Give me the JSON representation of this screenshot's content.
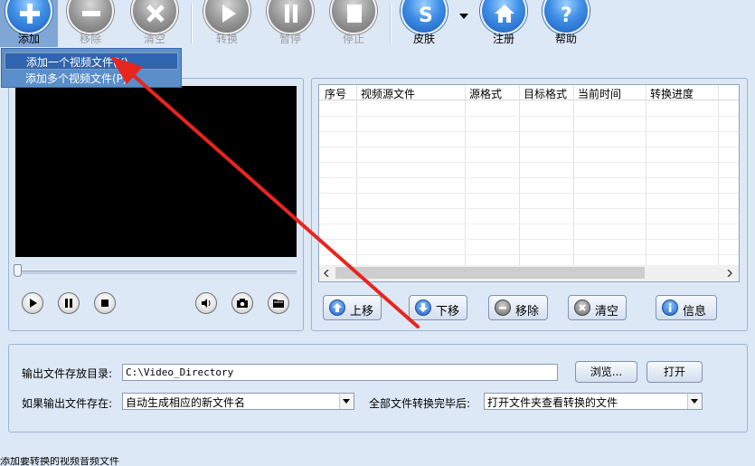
{
  "toolbar": {
    "add": "添加",
    "remove": "移除",
    "clear": "清空",
    "convert": "转换",
    "pause": "暂停",
    "stop": "停止",
    "skin": "皮肤",
    "register": "注册",
    "help": "帮助"
  },
  "add_menu": {
    "items": [
      "添加一个视频文件(Y)",
      "添加多个视频文件(P)"
    ]
  },
  "file_list": {
    "columns": [
      "序号",
      "视频源文件",
      "源格式",
      "目标格式",
      "当前时间",
      "转换进度"
    ]
  },
  "list_buttons": {
    "move_up": "上移",
    "move_down": "下移",
    "remove": "移除",
    "clear": "清空",
    "info": "信息"
  },
  "output": {
    "dir_label": "输出文件存放目录:",
    "dir_value": "C:\\Video_Directory",
    "browse": "浏览...",
    "open": "打开",
    "exists_label": "如果输出文件存在:",
    "exists_value": "自动生成相应的新文件名",
    "after_label": "全部文件转换完毕后:",
    "after_value": "打开文件夹查看转换的文件"
  },
  "status": {
    "text": "添加要转换的视频音频文件"
  },
  "colors": {
    "window_bg": "#dde8f6",
    "accent_blue": "#2f64b0",
    "annotation_arrow": "#e8251e"
  }
}
